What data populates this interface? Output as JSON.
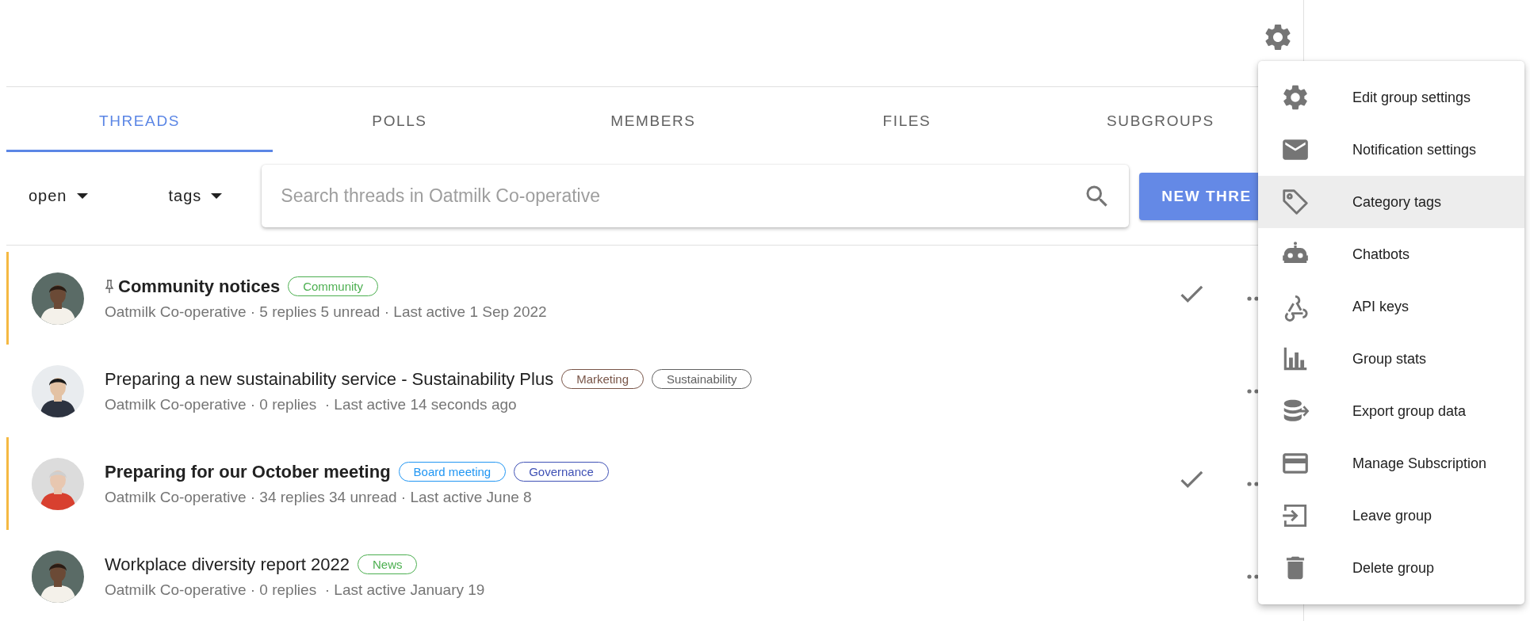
{
  "tabs": [
    {
      "label": "THREADS",
      "selected": true
    },
    {
      "label": "POLLS",
      "selected": false
    },
    {
      "label": "MEMBERS",
      "selected": false
    },
    {
      "label": "FILES",
      "selected": false
    },
    {
      "label": "SUBGROUPS",
      "selected": false
    }
  ],
  "filters": [
    {
      "label": "open"
    },
    {
      "label": "tags"
    }
  ],
  "search": {
    "placeholder": "Search threads in Oatmilk Co-operative"
  },
  "new_thread_button": "NEW THRE",
  "threads": [
    {
      "title": "Community notices",
      "pinned": true,
      "unread": true,
      "avatar": {
        "kind": "picture"
      },
      "tags": [
        {
          "label": "Community",
          "color": "#4caf50"
        }
      ],
      "meta": "Oatmilk Co-operative · 5 replies 5 unread · Last active 1 Sep 2022"
    },
    {
      "title": "Preparing a new sustainability service - Sustainability Plus",
      "pinned": false,
      "unread": false,
      "avatar": {
        "kind": "picture"
      },
      "tags": [
        {
          "label": "Marketing",
          "color": "#795548"
        },
        {
          "label": "Sustainability",
          "color": "#616161"
        }
      ],
      "meta": "Oatmilk Co-operative · 0 replies  · Last active 14 seconds ago"
    },
    {
      "title": "Preparing for our October meeting",
      "pinned": false,
      "unread": true,
      "avatar": {
        "kind": "picture"
      },
      "tags": [
        {
          "label": "Board meeting",
          "color": "#2196f3"
        },
        {
          "label": "Governance",
          "color": "#3f51b5"
        }
      ],
      "meta": "Oatmilk Co-operative · 34 replies 34 unread · Last active June 8"
    },
    {
      "title": "Workplace diversity report 2022",
      "pinned": false,
      "unread": false,
      "avatar": {
        "kind": "picture"
      },
      "tags": [
        {
          "label": "News",
          "color": "#4caf50"
        }
      ],
      "meta": "Oatmilk Co-operative · 0 replies  · Last active January 19"
    }
  ],
  "menu": {
    "items": [
      {
        "kind": "settings",
        "label": "Edit group settings",
        "selected": false
      },
      {
        "kind": "mail",
        "label": "Notification settings",
        "selected": false
      },
      {
        "kind": "tag",
        "label": "Category tags",
        "selected": true
      },
      {
        "kind": "robot",
        "label": "Chatbots",
        "selected": false
      },
      {
        "kind": "webhook",
        "label": "API keys",
        "selected": false
      },
      {
        "kind": "stats",
        "label": "Group stats",
        "selected": false
      },
      {
        "kind": "export",
        "label": "Export group data",
        "selected": false
      },
      {
        "kind": "card",
        "label": "Manage Subscription",
        "selected": false
      },
      {
        "kind": "leave",
        "label": "Leave group",
        "selected": false
      },
      {
        "kind": "delete",
        "label": "Delete group",
        "selected": false
      }
    ]
  }
}
